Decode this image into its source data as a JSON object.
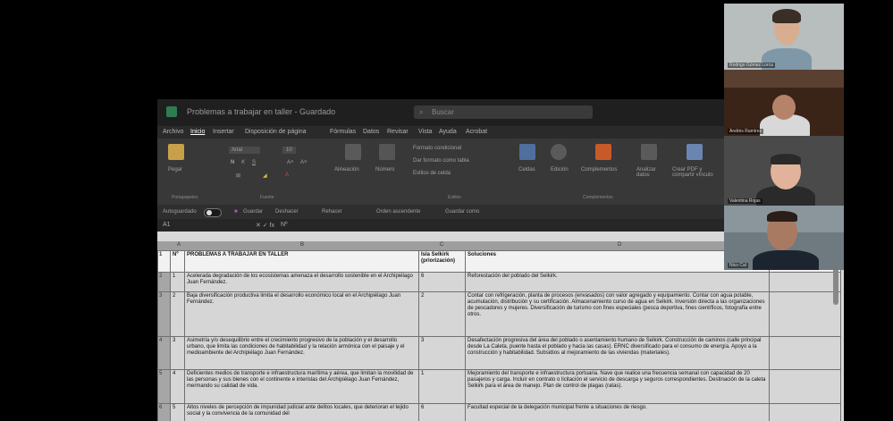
{
  "excel": {
    "doc_title": "Problemas a trabajar en taller - Guardado",
    "search_placeholder": "Buscar",
    "menu": [
      "Archivo",
      "Inicio",
      "Insertar",
      "Disposición de página",
      "Fórmulas",
      "Datos",
      "Revisar",
      "Vista",
      "Ayuda",
      "Acrobat"
    ],
    "ribbon": {
      "paste": "Pegar",
      "font_name": "Arial",
      "font_size": "10",
      "alignment": "Alineación",
      "number": "Número",
      "cond_format": "Formato condicional",
      "format_table": "Dar formato como tabla",
      "cell_styles": "Estilos de celda",
      "cells": "Celdas",
      "editing": "Edición",
      "complements": "Complementos",
      "analyze": "Analizar datos",
      "create_pdf": "Crear PDF y compartir vínculo",
      "group_clipboard": "Portapapeles",
      "group_font": "Fuente",
      "group_styles": "Estilos",
      "group_complements": "Complementos"
    },
    "qat": {
      "autosave": "Autoguardado",
      "save": "Guardar",
      "undo": "Deshacer",
      "redo": "Rehacer",
      "ascending": "Orden ascendente",
      "save_as": "Guardar como"
    },
    "cell_ref": "A1",
    "formula": "Nº",
    "col_headers": [
      "A",
      "B",
      "C",
      "D"
    ],
    "table_header": {
      "num": "Nº",
      "problems": "PROBLEMAS A TRABAJAR EN TALLER",
      "isla": "Isla Selkirk (priorización)",
      "solutions": "Soluciones"
    },
    "rows": [
      {
        "rownum": "2",
        "n": "1",
        "problem": "Acelerada degradación de los ecosistemas amenaza el desarrollo sostenible en el Archipiélago Juan Fernández.",
        "isla": "6",
        "solution": "Reforestación del poblado del Selkirk."
      },
      {
        "rownum": "3",
        "n": "2",
        "problem": "Baja diversificación productiva limita el desarrollo económico local en el Archipiélago Juan Fernández.",
        "isla": "2",
        "solution": "Contar con refrigeración, planta de procesos (envasados) con valor agregado y equipamiento. Contar con agua potable, acumulación, distribución y su certificación. Almacenamiento curso de agua en Selkirk. Inversión directa a las organizaciones de pescadores y mujeres. Diversificación de turismo con fines especiales (pesca deportiva, fines científicos, fotografía entre otros."
      },
      {
        "rownum": "4",
        "n": "3",
        "problem": "Asimetría y/o desequilibrio entre el crecimiento progresivo de la población y el desarrollo urbano, que limita las condiciones de habitabilidad y la relación armónica con el paisaje y el medioambiente del Archipiélago Juan Fernández.",
        "isla": "3",
        "solution": "Desafectación progresiva del área del poblado o asentamiento humano de Selkirk. Construcción de caminos (calle principal desde La Caleta, puente hasta el poblado y hacia las casas). ERNC diversificado para el consumo de energía. Apoyo a la construcción y habitabilidad. Subsidios al mejoramiento de las viviendas (materiales)."
      },
      {
        "rownum": "5",
        "n": "4",
        "problem": "Deficientes medios de transporte e infraestructura marítima y aérea, que limitan la movilidad de las personas y sus bienes con el continente e interislas del Archipiélago Juan Fernández, mermando su calidad de vida.",
        "isla": "1",
        "solution": "Mejoramiento del transporte e infraestructura portuaria. Nave que realice una frecuencia semanal con capacidad de 20 pasajeros y carga. Incluir en contrato o licitación el servicio de descarga y seguros correspondientes. Destinación de la caleta Selkirk para el área de manejo. Plan de control de plagas (ratas)."
      },
      {
        "rownum": "6",
        "n": "5",
        "problem": "Altos niveles de percepción de impunidad judicial ante delitos locales, que deterioran el tejido social y la convivencia de la comunidad del",
        "isla": "6",
        "solution": "Facultad especial de la delegación municipal frente a situaciones de riesgo."
      }
    ]
  },
  "participants": [
    {
      "name": "Rodrigo Gómez Lorca"
    },
    {
      "name": "Andrés Ramírez"
    },
    {
      "name": "Valentina Rojas"
    },
    {
      "name": "Nico Cal"
    }
  ],
  "colors": {
    "excel_green": "#2f7d4f",
    "ribbon_bg": "#383838",
    "sheet_bg": "#d6d6d6"
  }
}
